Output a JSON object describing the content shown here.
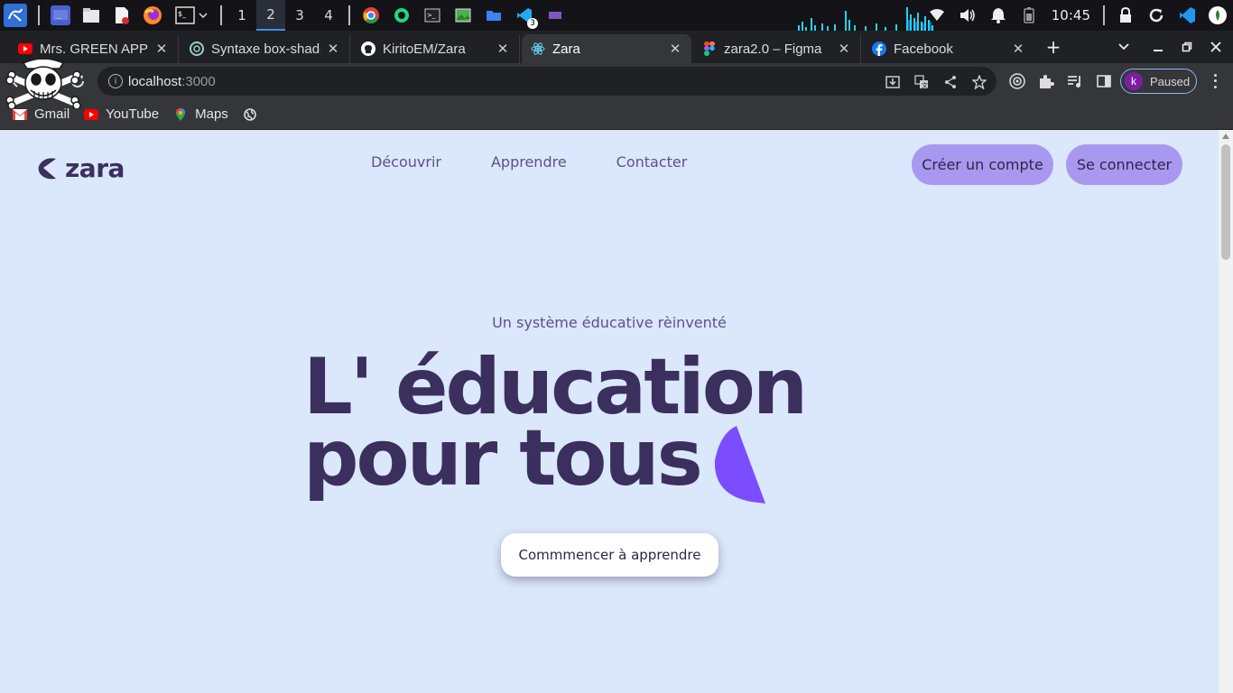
{
  "taskbar": {
    "workspaces": [
      "1",
      "2",
      "3",
      "4"
    ],
    "active_workspace": "2",
    "vscode_badge": "3",
    "clock": "10:45",
    "icons": [
      "kali-menu-icon",
      "desktop-icon",
      "files-icon",
      "text-editor-icon",
      "firefox-icon",
      "terminal-icon",
      "chrome-icon",
      "pycharm-icon",
      "terminal-small-icon",
      "image-viewer-icon",
      "folder-icon",
      "vscode-icon",
      "screen-icon"
    ],
    "tray_icons": [
      "wifi-icon",
      "volume-icon",
      "bell-icon",
      "battery-icon",
      "lock-icon",
      "refresh-icon",
      "vscode-tray-icon",
      "power-icon"
    ]
  },
  "tabs": [
    {
      "label": "Mrs. GREEN APPLE",
      "icon": "youtube-icon",
      "active": false
    },
    {
      "label": "Syntaxe box-shadow",
      "icon": "chatgpt-icon",
      "active": false
    },
    {
      "label": "KiritoEM/Zara",
      "icon": "github-icon",
      "active": false
    },
    {
      "label": "Zara",
      "icon": "react-icon",
      "active": true
    },
    {
      "label": "zara2.0 – Figma",
      "icon": "figma-icon",
      "active": false
    },
    {
      "label": "Facebook",
      "icon": "facebook-icon",
      "active": false
    }
  ],
  "address_bar": {
    "host": "localhost",
    "port": ":3000"
  },
  "profile": {
    "initial": "k",
    "status": "Paused"
  },
  "bookmarks": [
    {
      "label": "Gmail",
      "icon": "gmail-icon"
    },
    {
      "label": "YouTube",
      "icon": "youtube-icon"
    },
    {
      "label": "Maps",
      "icon": "maps-icon"
    },
    {
      "label": "",
      "icon": "globe-icon"
    }
  ],
  "site": {
    "logo": "zara",
    "nav": [
      "Découvrir",
      "Apprendre",
      "Contacter"
    ],
    "signup_label": "Créer un compte",
    "login_label": "Se connecter",
    "tagline": "Un système éducative rèinventé",
    "headline_line1": "L' éducation",
    "headline_line2": "pour tous",
    "cta_label": "Commmencer à apprendre"
  },
  "colors": {
    "page_bg": "#dbe7fa",
    "primary_text": "#3b2f5e",
    "nav_text": "#5b5289",
    "pill_button": "#a898f0",
    "accent_shape": "#7c4dff"
  }
}
